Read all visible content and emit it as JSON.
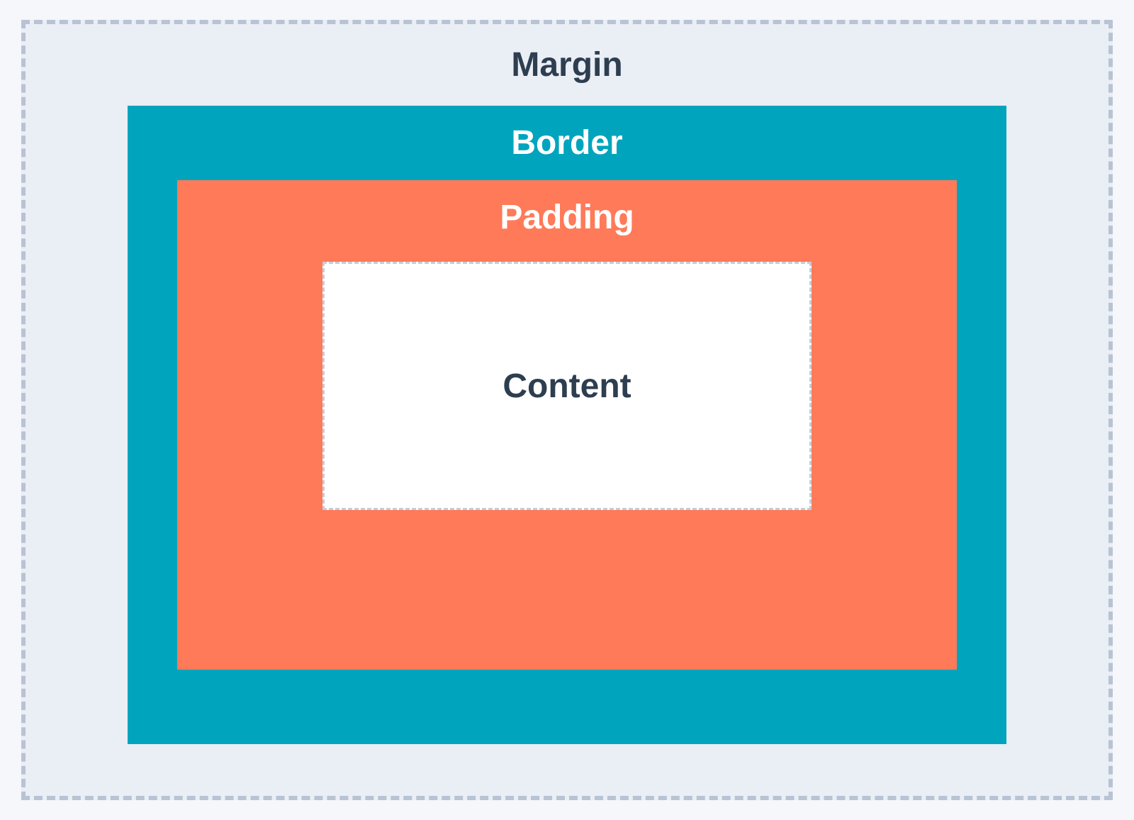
{
  "box_model": {
    "margin": {
      "label": "Margin",
      "background_color": "#eaeef5",
      "border_style": "dashed",
      "border_color": "#b8c3d4",
      "text_color": "#2d3e50"
    },
    "border": {
      "label": "Border",
      "background_color": "#00a4bd",
      "text_color": "#ffffff"
    },
    "padding": {
      "label": "Padding",
      "background_color": "#ff7a59",
      "text_color": "#ffffff"
    },
    "content": {
      "label": "Content",
      "background_color": "#ffffff",
      "border_style": "dashed",
      "border_color": "#c5cdd8",
      "text_color": "#2d3e50"
    }
  }
}
